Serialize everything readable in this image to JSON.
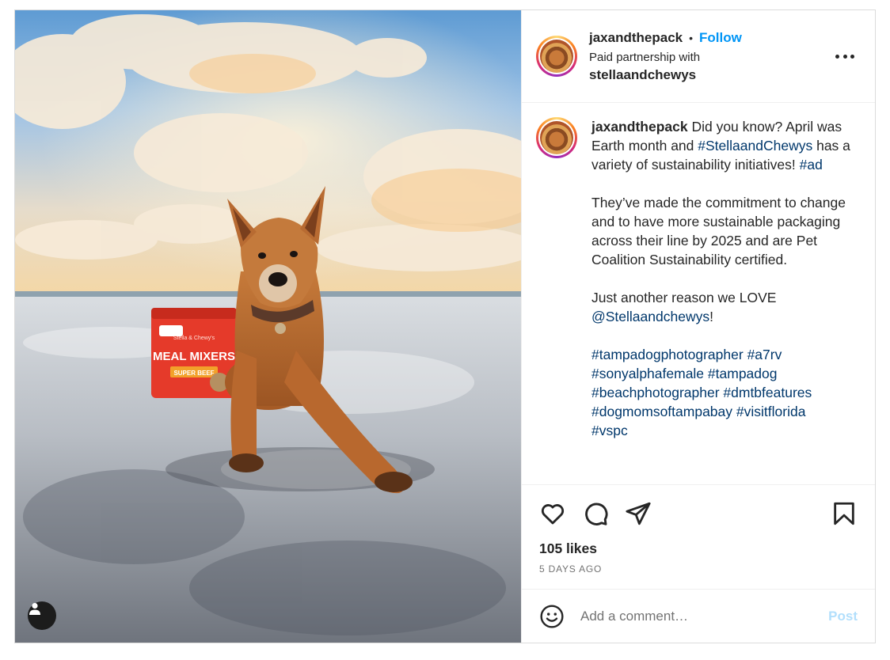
{
  "header": {
    "username": "jaxandthepack",
    "separator": "•",
    "follow_label": "Follow",
    "paid_partnership_text": "Paid partnership with",
    "partner_username": "stellaandchewys",
    "more_icon": "more-horizontal-icon"
  },
  "photo": {
    "bag_brand": "Stella & Chewy's",
    "bag_title": "MEAL MIXERS",
    "bag_flavor": "SUPER BEEF",
    "user_tag_icon": "user-tag-icon"
  },
  "caption": {
    "username": "jaxandthepack",
    "line1_text": "Did you know? April was Earth month and",
    "line1_tag": "#StellaandChewys",
    "line1_rest": "has a variety of sustainability initiatives!",
    "line1_tag2": "#ad",
    "paragraph2": "They’ve made the commitment to change and to have more sustainable packaging across their line by 2025 and are Pet Coalition Sustainability certified.",
    "paragraph3_text": "Just another reason we LOVE",
    "paragraph3_mention": "@Stellaandchewys",
    "paragraph3_end": "!",
    "hashtags": [
      "#tampadogphotographer",
      "#a7rv",
      "#sonyalphafemale",
      "#tampadog",
      "#beachphotographer",
      "#dmtbfeatures",
      "#dogmomsoftampabay",
      "#visitflorida",
      "#vspc"
    ]
  },
  "actions": {
    "like_icon": "heart-icon",
    "comment_icon": "comment-icon",
    "share_icon": "share-icon",
    "save_icon": "bookmark-icon",
    "likes": "105 likes",
    "time_ago": "5 DAYS AGO"
  },
  "comment": {
    "emoji_icon": "emoji-icon",
    "placeholder": "Add a comment…",
    "post_label": "Post"
  },
  "colors": {
    "accent": "#0095f6",
    "hashtag": "#00376b",
    "post_disabled": "#b2dffc"
  }
}
